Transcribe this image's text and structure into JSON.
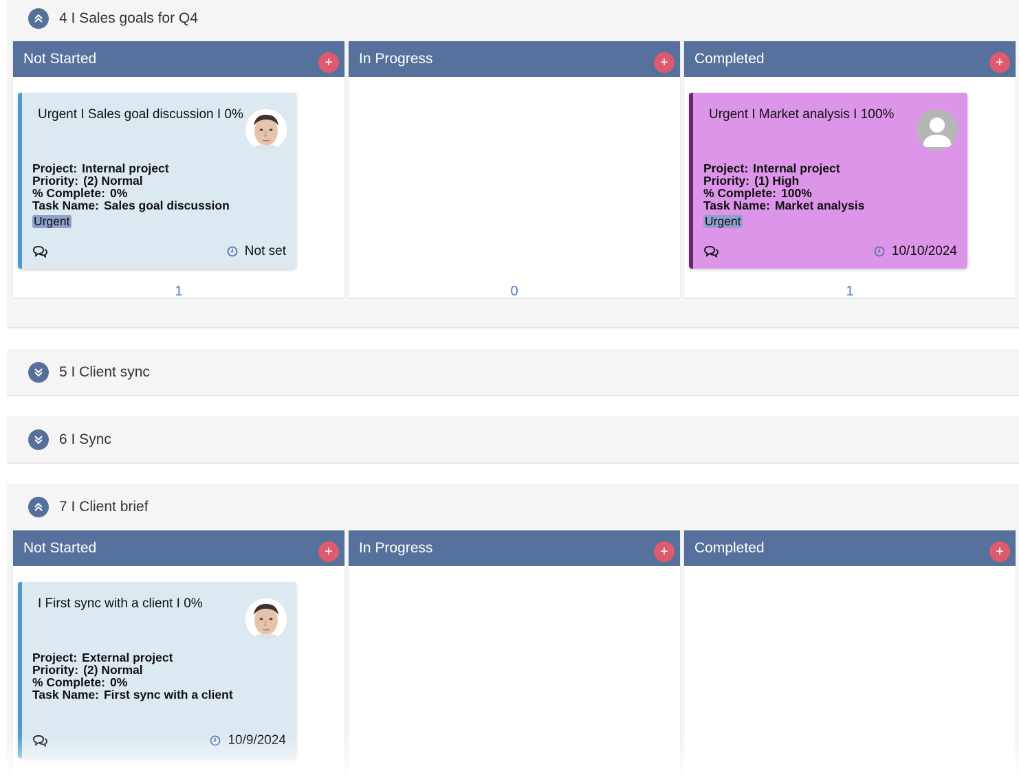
{
  "groups": [
    {
      "title": "4 I Sales goals for Q4",
      "expanded": true,
      "columns": [
        {
          "title": "Not Started",
          "count": "1"
        },
        {
          "title": "In Progress",
          "count": "0"
        },
        {
          "title": "Completed",
          "count": "1"
        }
      ]
    },
    {
      "title": "5 I Client sync",
      "expanded": false
    },
    {
      "title": "6 I Sync",
      "expanded": false
    },
    {
      "title": "7 I Client brief",
      "expanded": true,
      "columns": [
        {
          "title": "Not Started"
        },
        {
          "title": "In Progress"
        },
        {
          "title": "Completed"
        }
      ]
    }
  ],
  "add_symbol": "+",
  "cards": {
    "sales_goal": {
      "title": "Urgent I Sales goal discussion I 0%",
      "project_label": "Project:",
      "project": "Internal project",
      "priority_label": "Priority:",
      "priority": "(2) Normal",
      "complete_label": "% Complete:",
      "complete": "0%",
      "task_label": "Task Name:",
      "task": "Sales goal discussion",
      "tag": "Urgent",
      "due": "Not set",
      "color": "#dce9f1"
    },
    "market_analysis": {
      "title": "Urgent I Market analysis I 100%",
      "project_label": "Project:",
      "project": "Internal project",
      "priority_label": "Priority:",
      "priority": "(1) High",
      "complete_label": "% Complete:",
      "complete": "100%",
      "task_label": "Task Name:",
      "task": "Market analysis",
      "tag": "Urgent",
      "due": "10/10/2024",
      "color": "#dc95e8"
    },
    "first_sync": {
      "title": "I First sync with a client I 0%",
      "project_label": "Project:",
      "project": "External project",
      "priority_label": "Priority:",
      "priority": "(2) Normal",
      "complete_label": "% Complete:",
      "complete": "0%",
      "task_label": "Task Name:",
      "task": "First sync with a client",
      "due": "10/9/2024",
      "color": "#dce9f1"
    }
  },
  "colors": {
    "column_header": "#56729c",
    "add_button": "#de5b6f",
    "count_text": "#4a78c2",
    "tag_bg": "#8fa0cf"
  },
  "icons": {
    "expand": "double-chevron-up-icon",
    "collapse": "double-chevron-down-icon",
    "comment": "comments-icon",
    "clock": "clock-icon"
  }
}
